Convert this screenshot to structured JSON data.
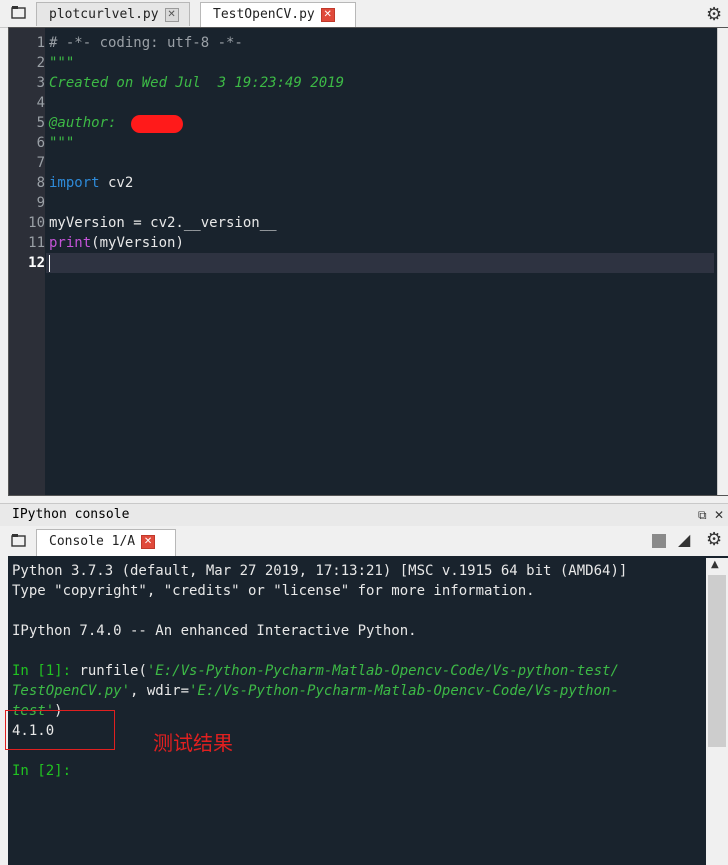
{
  "editor": {
    "tabs": [
      {
        "label": "plotcurlvel.py",
        "active": false
      },
      {
        "label": "TestOpenCV.py",
        "active": true
      }
    ],
    "lines": [
      {
        "n": "1",
        "text": "# -*- coding: utf-8 -*-"
      },
      {
        "n": "2",
        "text": "\"\"\""
      },
      {
        "n": "3",
        "text": "Created on Wed Jul  3 19:23:49 2019"
      },
      {
        "n": "4",
        "text": ""
      },
      {
        "n": "5",
        "text": "@author: "
      },
      {
        "n": "6",
        "text": "\"\"\""
      },
      {
        "n": "7",
        "text": ""
      },
      {
        "n": "8",
        "kw": "import",
        "rest": " cv2"
      },
      {
        "n": "9",
        "text": ""
      },
      {
        "n": "10",
        "text": "myVersion = cv2.__version__"
      },
      {
        "n": "11",
        "builtin": "print",
        "rest": "(myVersion)"
      },
      {
        "n": "12",
        "text": ""
      }
    ]
  },
  "console": {
    "panel_title": "IPython console",
    "tab_label": "Console 1/A",
    "lines": {
      "l1": "Python 3.7.3 (default, Mar 27 2019, 17:13:21) [MSC v.1915 64 bit (AMD64)]",
      "l2": "Type \"copyright\", \"credits\" or \"license\" for more information.",
      "l3": "IPython 7.4.0 -- An enhanced Interactive Python.",
      "in1_prompt": "In [1]:",
      "in1_call": " runfile(",
      "in1_path_a": "'E:/Vs-Python-Pycharm-Matlab-Opencv-Code/Vs-python-test/",
      "in1_path_b": "TestOpenCV.py'",
      "in1_mid": ", wdir=",
      "in1_wdir_a": "'E:/Vs-Python-Pycharm-Matlab-Opencv-Code/Vs-python-",
      "in1_wdir_b": "test'",
      "in1_close": ")",
      "output": "4.1.0",
      "in2_prompt": "In [2]:"
    },
    "annotation": "测试结果"
  },
  "colors": {
    "editor_bg": "#19232d",
    "docstring": "#3dba46",
    "keyword": "#2e8ad8",
    "builtin": "#c454d8",
    "prompt": "#21c321",
    "annotation": "#e02020"
  },
  "icons": [
    "browse-tabs-icon",
    "gear-icon",
    "undock-icon",
    "close-icon",
    "stop-icon",
    "eraser-icon",
    "scroll-up-icon"
  ]
}
